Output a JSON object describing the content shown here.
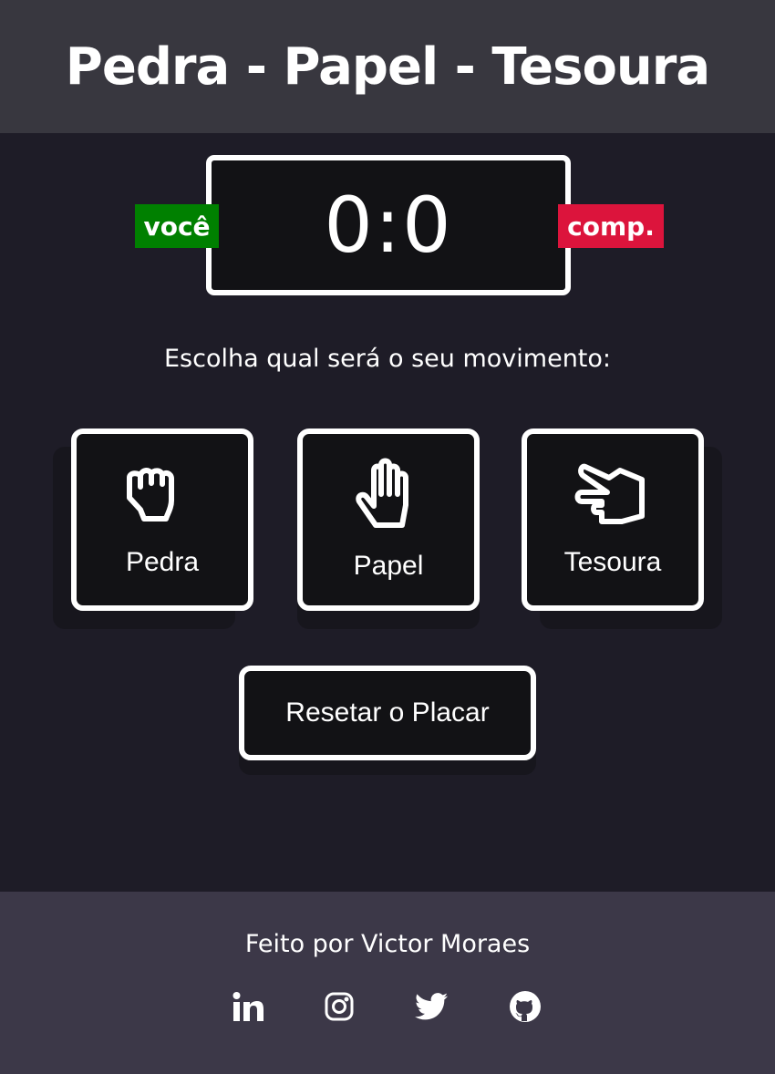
{
  "header": {
    "title": "Pedra - Papel - Tesoura"
  },
  "score": {
    "value": "0:0",
    "player_label": "você",
    "computer_label": "comp.",
    "player_color": "#008000",
    "computer_color": "#dc143c"
  },
  "prompt": "Escolha qual será o seu movimento:",
  "moves": [
    {
      "label": "Pedra",
      "icon": "fist-icon"
    },
    {
      "label": "Papel",
      "icon": "hand-paper-icon"
    },
    {
      "label": "Tesoura",
      "icon": "hand-scissors-icon"
    }
  ],
  "reset_label": "Resetar o Placar",
  "footer": {
    "credit": "Feito por Victor Moraes",
    "social": [
      "linkedin-icon",
      "instagram-icon",
      "twitter-icon",
      "github-icon"
    ]
  }
}
